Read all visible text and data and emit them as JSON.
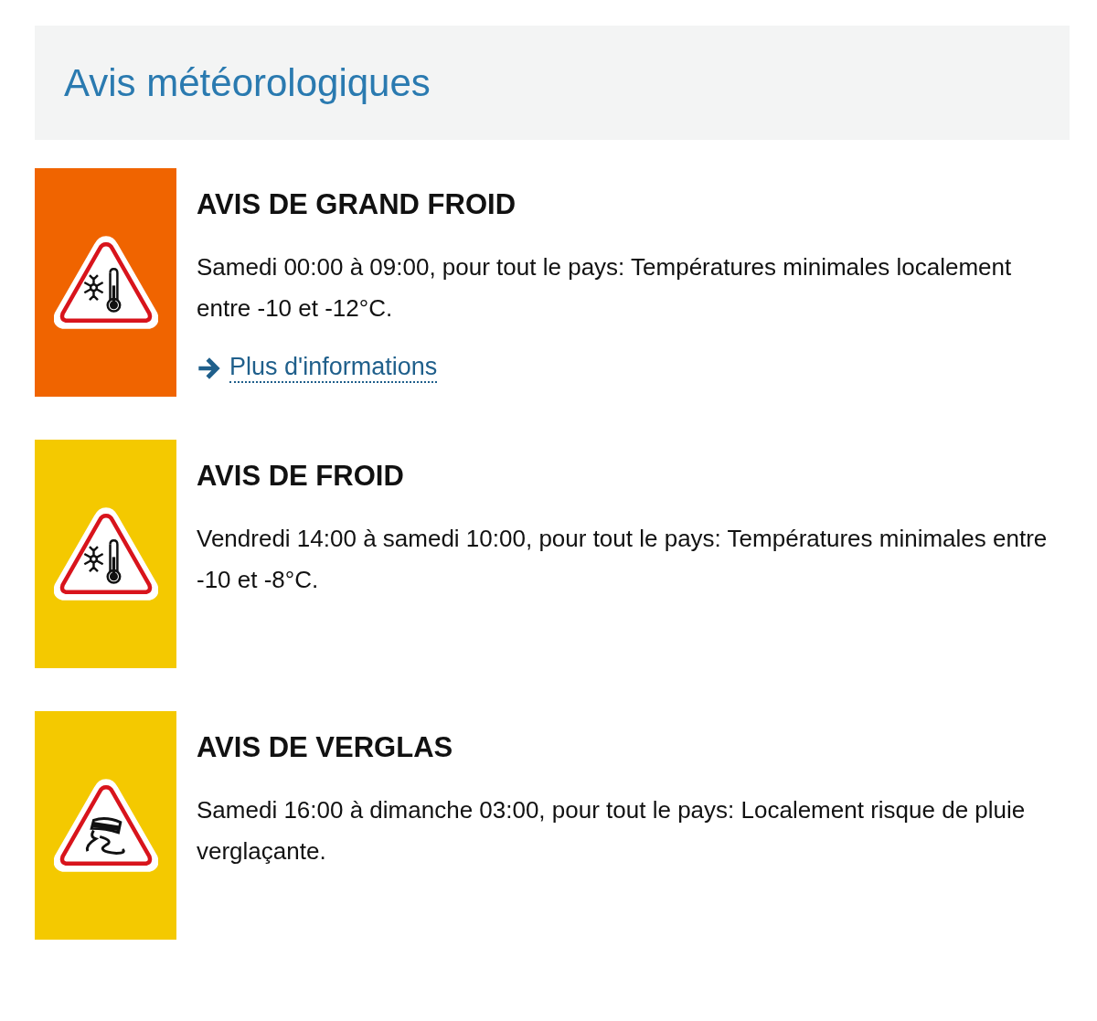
{
  "header": {
    "title": "Avis météorologiques"
  },
  "alerts": [
    {
      "kind": "cold",
      "color": "#f06400",
      "title": "AVIS DE GRAND FROID",
      "text": "Samedi 00:00 à 09:00, pour tout le pays: Températures minimales localement entre -10 et -12°C.",
      "link": "Plus d'informations"
    },
    {
      "kind": "cold",
      "color": "#f4c900",
      "title": "AVIS DE FROID",
      "text": "Vendredi 14:00 à samedi 10:00, pour tout le pays: Températures minimales entre -10 et -8°C."
    },
    {
      "kind": "ice",
      "color": "#f4c900",
      "title": "AVIS DE VERGLAS",
      "text": "Samedi 16:00 à dimanche 03:00, pour tout le pays: Localement risque de pluie verglaçante."
    }
  ]
}
